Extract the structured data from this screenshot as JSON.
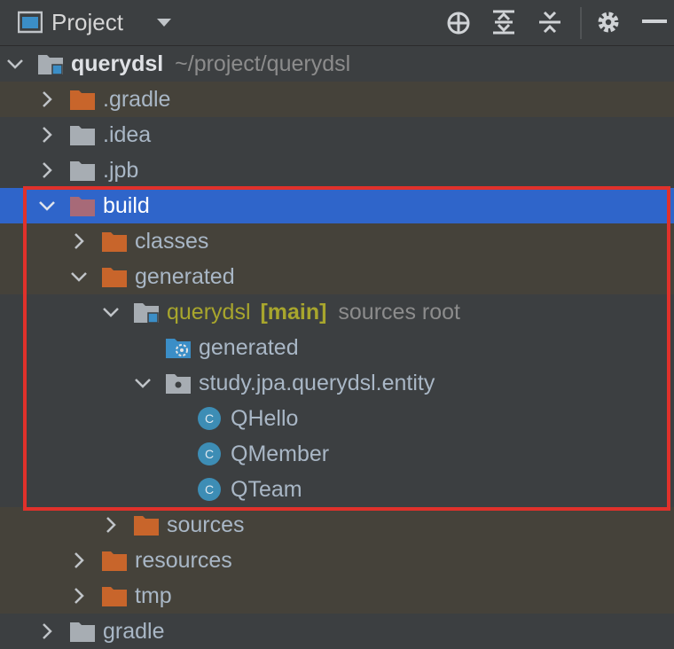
{
  "toolbar": {
    "title": "Project",
    "icons": [
      "project-view-icon",
      "dropdown-chevron-icon",
      "locate-file-icon",
      "expand-all-icon",
      "collapse-all-icon",
      "gear-icon",
      "hide-icon"
    ]
  },
  "tree": {
    "root": {
      "name": "querydsl",
      "path": "~/project/querydsl"
    },
    "items": {
      "gradle_dir": ".gradle",
      "idea": ".idea",
      "jpb": ".jpb",
      "build": "build",
      "classes": "classes",
      "generated": "generated",
      "querydsl_src": "querydsl",
      "main_tag": "[main]",
      "sources_root": "sources root",
      "generated_inner": "generated",
      "package": "study.jpa.querydsl.entity",
      "qhello": "QHello",
      "qmember": "QMember",
      "qteam": "QTeam",
      "sources": "sources",
      "resources": "resources",
      "tmp": "tmp",
      "gradle": "gradle"
    }
  },
  "colors": {
    "background": "#3c3f41",
    "selection": "#2f65ca",
    "excluded_row": "#45423a",
    "excluded_text": "#a8a62d",
    "folder_orange": "#c8652b",
    "folder_gray": "#a7adb3",
    "class_badge": "#3d8db5",
    "highlight_border": "#e0312b"
  }
}
